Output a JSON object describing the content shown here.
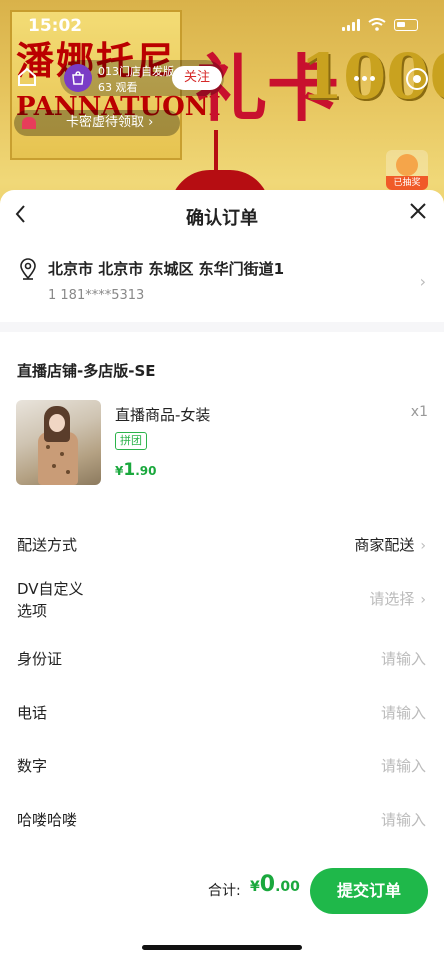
{
  "status_bar": {
    "time": "15:02"
  },
  "live": {
    "banner_brand_cn": "潘娜托尼",
    "banner_brand_en": "PANNATUONI",
    "banner_text": "礼卡",
    "banner_number": "1000",
    "host_name": "013门店自发版",
    "viewers": "63 观看",
    "follow_label": "关注",
    "coupon_tip": "卡密虚待领取 ›",
    "gift_label": "已抽奖"
  },
  "sheet": {
    "title": "确认订单",
    "address": {
      "line": "北京市 北京市 东城区 东华门街道1",
      "contact": "1  181****5313"
    },
    "shop_name": "直播店铺-多店版-SE",
    "product": {
      "name": "直播商品-女装",
      "qty": "x1",
      "tag": "拼团",
      "price_currency": "¥",
      "price_int": "1",
      "price_dec": ".90"
    },
    "fields": [
      {
        "label": "配送方式",
        "value": "商家配送"
      },
      {
        "label": "DV自定义\n选项",
        "value": "请选择"
      },
      {
        "label": "身份证",
        "value": "请输入"
      },
      {
        "label": "电话",
        "value": "请输入"
      },
      {
        "label": "数字",
        "value": "请输入"
      },
      {
        "label": "哈喽哈喽",
        "value": "请输入"
      }
    ],
    "total_label": "合计:",
    "total_currency": "¥",
    "total_int": "0",
    "total_dec": ".00",
    "submit_label": "提交订单"
  },
  "colors": {
    "accent": "#1fb84a",
    "price": "#1aa83d",
    "follow": "#d62a2a"
  }
}
